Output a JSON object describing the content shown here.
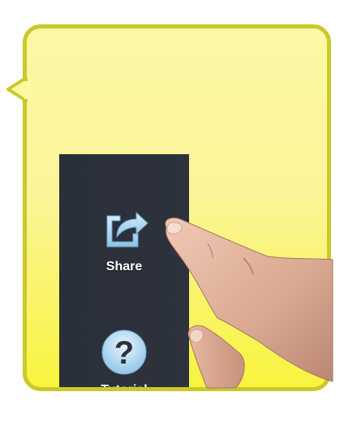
{
  "menu": {
    "items": [
      {
        "label": "Share",
        "icon": "share-icon"
      },
      {
        "label": "Tutorial",
        "icon": "question-icon"
      }
    ]
  },
  "colors": {
    "bubble_fill_top": "#fbf7a3",
    "bubble_fill_bottom": "#f8f43e",
    "bubble_border": "#c9c92a",
    "panel_bg": "#2c313c",
    "icon_blue": "#bfe1f5",
    "label_text": "#ffffff"
  }
}
